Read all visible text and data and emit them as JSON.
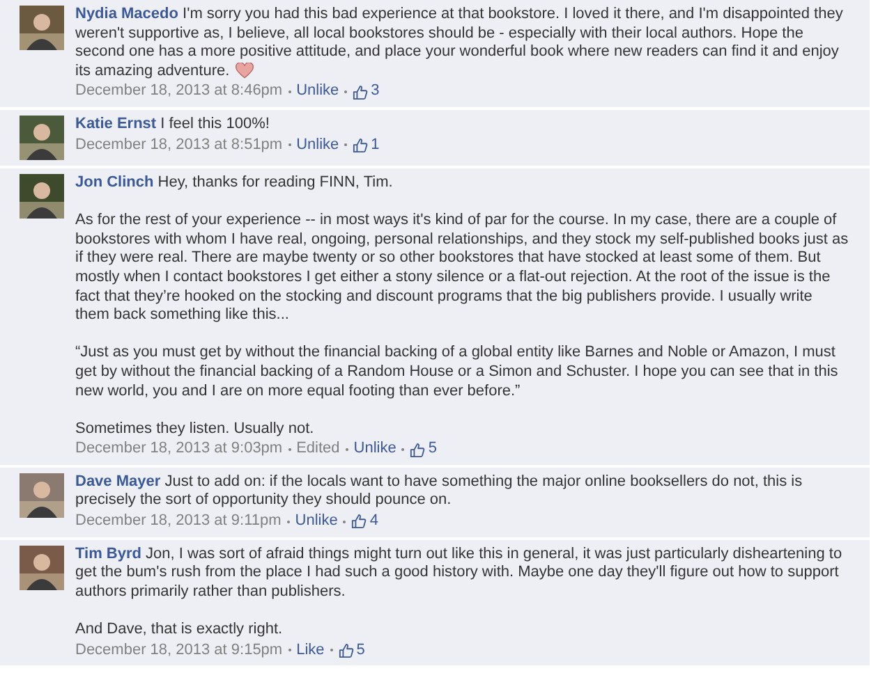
{
  "comments": [
    {
      "author": "Nydia Macedo",
      "paragraphs": [
        "I'm sorry you had this bad experience at that bookstore. I loved it there, and I'm disappointed they weren't supportive as, I believe, all local bookstores should be - especially with their local authors. Hope the second one has a more positive attitude, and place your wonderful book where new readers can find it and enjoy its amazing adventure."
      ],
      "heart": true,
      "time": "December 18, 2013 at 8:46pm",
      "action": "Unlike",
      "likes": "3"
    },
    {
      "author": "Katie Ernst",
      "paragraphs": [
        "I feel this 100%!"
      ],
      "time": "December 18, 2013 at 8:51pm",
      "action": "Unlike",
      "likes": "1"
    },
    {
      "author": "Jon Clinch",
      "paragraphs": [
        "Hey, thanks for reading FINN, Tim.",
        "As for the rest of your experience -- in most ways it's kind of par for the course. In my case, there are a couple of bookstores with whom I have real, ongoing, personal relationships, and they stock my self-published books just as if they were real. There are maybe twenty or so other bookstores that have stocked at least some of them. But mostly when I contact bookstores I get either a stony silence or a flat-out rejection. At the root of the issue is the fact that they’re hooked on the stocking and discount programs that the big publishers provide. I usually write them back something like this...",
        "“Just as you must get by without the financial backing of a global entity like Barnes and Noble or Amazon, I must get by without the financial backing of a Random House or a Simon and Schuster. I hope you can see that in this new world, you and I are on more equal footing than ever before.”",
        "Sometimes they listen. Usually not."
      ],
      "time": "December 18, 2013 at 9:03pm",
      "edited": "Edited",
      "action": "Unlike",
      "likes": "5"
    },
    {
      "author": "Dave Mayer",
      "paragraphs": [
        "Just to add on: if the locals want to have something the major online booksellers do not, this is precisely the sort of opportunity they should pounce on."
      ],
      "time": "December 18, 2013 at 9:11pm",
      "action": "Unlike",
      "likes": "4"
    },
    {
      "author": "Tim Byrd",
      "paragraphs": [
        "Jon, I was sort of afraid things might turn out like this in general, it was just particularly disheartening to get the bum's rush from the place I had such a good history with. Maybe one day they'll figure out how to support authors primarily rather than publishers.",
        "And Dave, that is exactly right."
      ],
      "time": "December 18, 2013 at 9:15pm",
      "action": "Like",
      "likes": "5"
    }
  ]
}
